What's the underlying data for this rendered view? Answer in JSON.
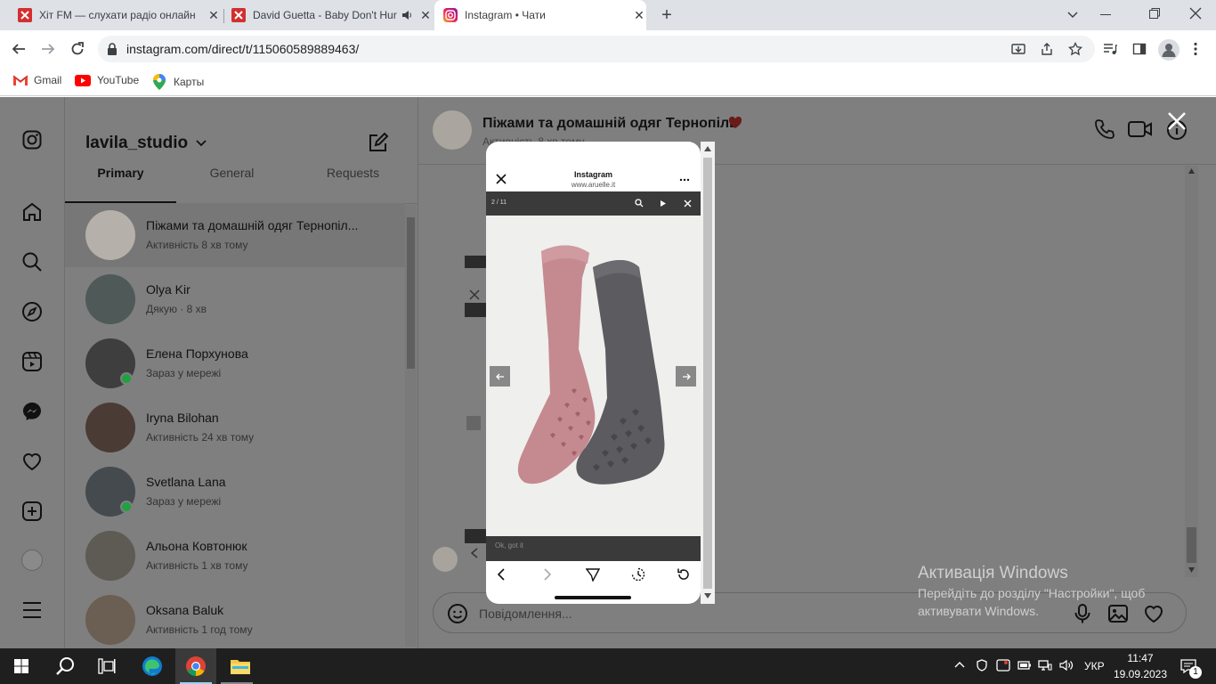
{
  "browser": {
    "tabs": [
      {
        "title": "Хіт FM — слухати радіо онлайн",
        "active": false
      },
      {
        "title": "David Guetta - Baby Don't Hurt Me",
        "active": false
      },
      {
        "title": "Instagram • Чати",
        "active": true
      }
    ],
    "url": "instagram.com/direct/t/115060589889463/",
    "bookmarks": [
      "Gmail",
      "YouTube",
      "Карты"
    ]
  },
  "instagram": {
    "username": "lavila_studio",
    "tabs": [
      "Primary",
      "General",
      "Requests"
    ],
    "conversations": [
      {
        "name": "Піжами та домашній одяг Тернопіл...",
        "status": "Активність 8 хв тому",
        "online": false
      },
      {
        "name": "Olya Kir",
        "status": "Дякую · 8 хв",
        "online": false
      },
      {
        "name": "Елена Порхунова",
        "status": "Зараз у мережі",
        "online": true
      },
      {
        "name": "Iryna Bilohan",
        "status": "Активність 24 хв тому",
        "online": false
      },
      {
        "name": "Svetlana Lana",
        "status": "Зараз у мережі",
        "online": true
      },
      {
        "name": "Альона Ковтонюк",
        "status": "Активність 1 хв тому",
        "online": false
      },
      {
        "name": "Oksana Baluk",
        "status": "Активність 1 год тому",
        "online": false
      }
    ],
    "chat": {
      "title": "Піжами та домашній одяг Тернопіль",
      "status": "Активність 8 хв тому",
      "message_placeholder": "Повідомлення...",
      "bg_button_text": "Ok, got it"
    },
    "modal": {
      "browser_title": "Instagram",
      "browser_domain": "www.aruelle.it",
      "image_counter": "2 / 11",
      "hint_text": "Ok, got it"
    }
  },
  "watermark": {
    "title": "Активація Windows",
    "line1": "Перейдіть до розділу \"Настройки\", щоб",
    "line2": "активувати Windows."
  },
  "taskbar": {
    "language": "УКР",
    "time": "11:47",
    "date": "19.09.2023",
    "notifications": "1"
  },
  "colors": {
    "chrome_bg": "#dee1e6",
    "dim_overlay": "#7f7f7f",
    "online": "#1fa23f",
    "sock_pink": "#c48a90",
    "sock_grey": "#5a5a5e",
    "taskbar": "#1f1f1f"
  }
}
